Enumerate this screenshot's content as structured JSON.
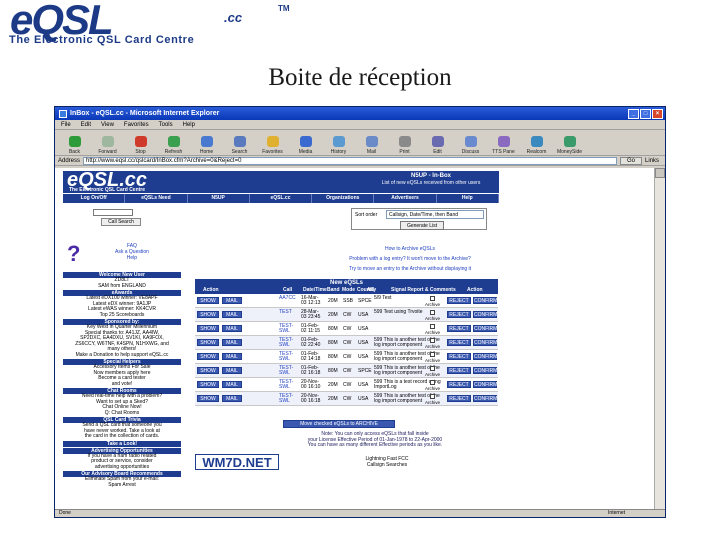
{
  "slide": {
    "logo_main": "eQSL",
    "logo_cc": ".cc",
    "logo_tm": "TM",
    "logo_sub": "The Electronic QSL Card Centre",
    "title": "Boite de réception"
  },
  "browser": {
    "title": "InBox - eQSL.cc - Microsoft Internet Explorer",
    "menu": [
      "File",
      "Edit",
      "View",
      "Favorites",
      "Tools",
      "Help"
    ],
    "toolbar": [
      {
        "label": "Back",
        "icon": "back-arrow-icon",
        "color": "#2e9b3a"
      },
      {
        "label": "Forward",
        "icon": "forward-arrow-icon",
        "color": "#9fb79f"
      },
      {
        "label": "Stop",
        "icon": "stop-icon",
        "color": "#d03a2a"
      },
      {
        "label": "Refresh",
        "icon": "refresh-icon",
        "color": "#3aa050"
      },
      {
        "label": "Home",
        "icon": "home-icon",
        "color": "#4a7ad0"
      },
      {
        "label": "Search",
        "icon": "search-icon",
        "color": "#5a7ac0"
      },
      {
        "label": "Favorites",
        "icon": "favorites-icon",
        "color": "#e0b030"
      },
      {
        "label": "Media",
        "icon": "media-icon",
        "color": "#3a6ad0"
      },
      {
        "label": "History",
        "icon": "history-icon",
        "color": "#5a9ad0"
      },
      {
        "label": "Mail",
        "icon": "mail-icon",
        "color": "#6a8ac8"
      },
      {
        "label": "Print",
        "icon": "print-icon",
        "color": "#8a8a8a"
      },
      {
        "label": "Edit",
        "icon": "edit-icon",
        "color": "#6a6ab0"
      },
      {
        "label": "Discuss",
        "icon": "discuss-icon",
        "color": "#6a8ad0"
      },
      {
        "label": "TTS Pane",
        "icon": "tts-icon",
        "color": "#8a6ac0"
      },
      {
        "label": "Realcom",
        "icon": "realcom-icon",
        "color": "#3a8ac0"
      },
      {
        "label": "MoneySide",
        "icon": "money-icon",
        "color": "#3a9a6a"
      }
    ],
    "address_label": "Address",
    "address_url": "http://www.eqsl.cc/qslcard/InBox.cfm?Archive=0&Reject=0",
    "go_label": "Go",
    "links_label": "Links",
    "status_left": "Done",
    "status_zone": "Internet"
  },
  "page": {
    "banner_logo": "eQSL.cc",
    "banner_sub": "The Electronic QSL Card Centre",
    "header_line1": "N5UP - In-Box",
    "header_line2": "List of new eQSLs received from other users",
    "nav": [
      "Log On/Off",
      "eQSLs Need",
      "N5UP",
      "eQSL.cc",
      "Organizations",
      "Advertisers",
      "Help"
    ],
    "call_search_label": "Call Search",
    "help_links": [
      "FAQ",
      "Ask a Question",
      "Help"
    ],
    "sidebar_sections": [
      {
        "header": "Welcome New User",
        "text": "ZD8LT\nSAM from ENGLAND"
      },
      {
        "header": "eAwards",
        "text": "Latest eDX100 winner: VE8APF\nLatest eDX winner: 9A1JP\nLatest eWAS winner: KK4CVR\nTop 25 Scoreboards"
      },
      {
        "header": "Sponsored by:",
        "text": "Key West in Quarter Millennium\nSpecial thanks to: A41JZ, AA4IW,\nSP2DXC, EA4DXU, SV1KI, KA9FOX,\nZS6CCY, W6TNF, K4SPN, N1HXWG, and\nmany others!\nMake a Donation to help support eQSL.cc"
      },
      {
        "header": "Special Helpers",
        "text": "Accessory Items For Sale\nNow members apply here\nBecome a card tester\nand vote!"
      },
      {
        "header": "Chat Rooms",
        "text": "Need real-time help with a problem?\nWant to set up a Sked?\nChat Online Now!\nQ: Chat Rooms"
      },
      {
        "header": "QSL Card Trivia",
        "text": "Send a QSL card that someone you\nhave never worked. Take a look at\nthe card in the collection of cards."
      },
      {
        "header": "Take a Look!",
        "text": ""
      },
      {
        "header": "Advertising Opportunities",
        "text": "If you have a ham radio related\nproduct or service, consider\nadvertising opportunities"
      },
      {
        "header": "Our Advisory Board Recommends",
        "text": "Eliminate Spam from your e-mail:\nSpam Arrest"
      }
    ],
    "sort_label": "Sort order",
    "sort_value": "Callsign, Date/Time, then Band",
    "sort_button": "Generate List",
    "links_block": [
      {
        "text": "How to Archive eQSLs",
        "color": "link"
      },
      {
        "text": "Problem with a log entry? It won't move to the Archive?",
        "color": "link"
      },
      {
        "text": "Try to move an entry to the Archive without displaying it",
        "color": "link"
      }
    ],
    "new_header": "New eQSLs",
    "columns": [
      "Action",
      "Call",
      "Date/Time",
      "Band",
      "Mode",
      "Country",
      "AG",
      "Signal Report & Comments",
      "Action"
    ],
    "rows": [
      {
        "call": "AA7CC",
        "datetime": "16-Mar-03 12:13",
        "band": "20M",
        "mode": "SSB",
        "country": "SPCE",
        "comment": "5/9 Test",
        "archive": "Archive"
      },
      {
        "call": "TEST",
        "datetime": "28-Mar-03 23:45",
        "band": "20M",
        "mode": "CW",
        "country": "USA",
        "comment": "599 Test using Trvoite",
        "archive": "Archive"
      },
      {
        "call": "TEST-SWL",
        "datetime": "01-Feb-02 11:15",
        "band": "80M",
        "mode": "CW",
        "country": "USA",
        "comment": "",
        "archive": "Archive"
      },
      {
        "call": "TEST-SWL",
        "datetime": "01-Feb-02 22:40",
        "band": "80M",
        "mode": "CW",
        "country": "USA",
        "comment": "599 This is another test of the log import component",
        "archive": "Archive"
      },
      {
        "call": "TEST-SWL",
        "datetime": "01-Feb-02 14:18",
        "band": "80M",
        "mode": "CW",
        "country": "USA",
        "comment": "599 This is another test of the log import component",
        "archive": "Archive"
      },
      {
        "call": "TEST-SWL",
        "datetime": "01-Feb-02 16:18",
        "band": "80M",
        "mode": "CW",
        "country": "SPCE",
        "comment": "599 This is another test of the log import component",
        "archive": "Archive"
      },
      {
        "call": "TEST-SWL",
        "datetime": "20-Nov-00 16:10",
        "band": "20M",
        "mode": "CW",
        "country": "USA",
        "comment": "599 This is a test record using ImportLog",
        "archive": "Archive"
      },
      {
        "call": "TEST-SWL",
        "datetime": "20-Nov-00 16:18",
        "band": "20M",
        "mode": "CW",
        "country": "USA",
        "comment": "599 This is another test of the log import component",
        "archive": "Archive"
      }
    ],
    "btn_labels": {
      "show": "SHOW",
      "mail": "MAIL",
      "reject": "REJECT",
      "confirm": "CONFIRM"
    },
    "move_button": "Move checked eQSLs to ARCHIVE",
    "note": "Note: You can only access eQSLs that fall inside\nyour License Effective Period of 01-Jan-1978 to 22-Apr-2000\nYou can have as many different Effective periods as you like.",
    "ad_logo": "WM7D.NET",
    "ad_text": "Lightning Fast FCC\nCallsign Searches"
  }
}
